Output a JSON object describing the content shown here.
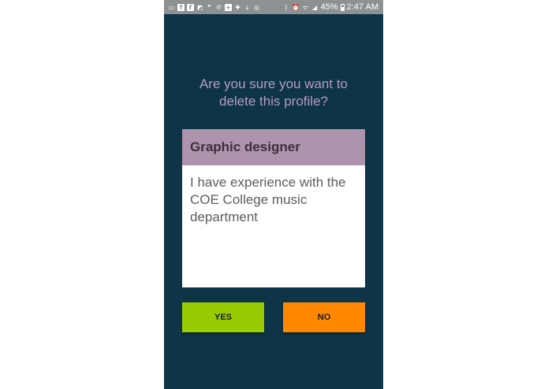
{
  "status_bar": {
    "battery_text": "45%",
    "time": "2:47 AM"
  },
  "dialog": {
    "question": "Are you sure you want to\ndelete this profile?",
    "profile": {
      "title": "Graphic designer",
      "description": "I have experience with the COE College music department"
    },
    "yes_label": "YES",
    "no_label": "NO"
  },
  "colors": {
    "background": "#0d3447",
    "question_text": "#b79cc0",
    "card_header": "#ad93ab",
    "yes_button": "#99cc00",
    "no_button": "#ff8800",
    "status_bar": "#8e9191"
  }
}
